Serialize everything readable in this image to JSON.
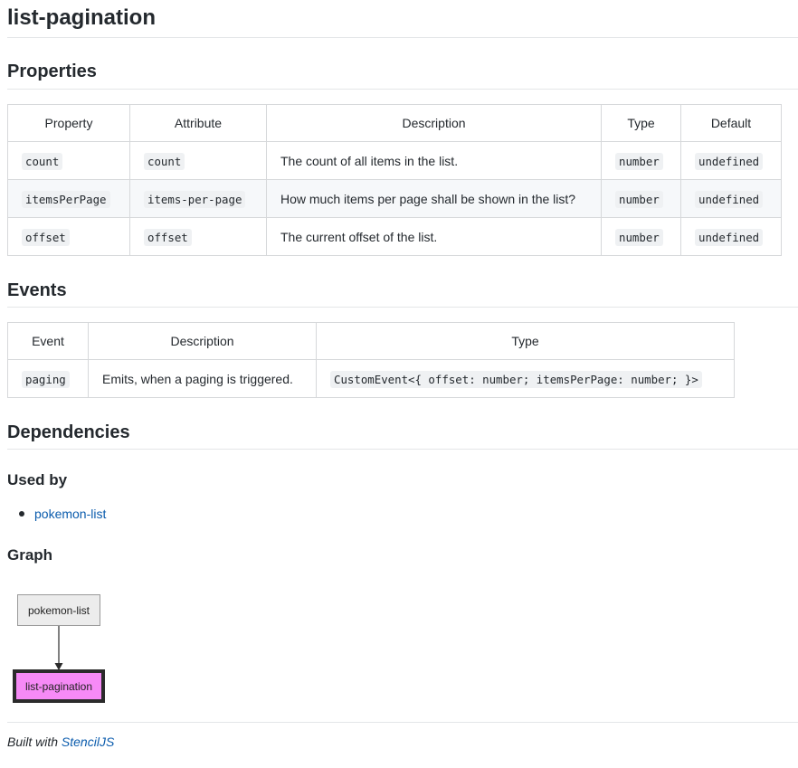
{
  "title": "list-pagination",
  "properties": {
    "heading": "Properties",
    "columns": [
      "Property",
      "Attribute",
      "Description",
      "Type",
      "Default"
    ],
    "rows": [
      {
        "property": "count",
        "attribute": "count",
        "description": "The count of all items in the list.",
        "type": "number",
        "default": "undefined"
      },
      {
        "property": "itemsPerPage",
        "attribute": "items-per-page",
        "description": "How much items per page shall be shown in the list?",
        "type": "number",
        "default": "undefined"
      },
      {
        "property": "offset",
        "attribute": "offset",
        "description": "The current offset of the list.",
        "type": "number",
        "default": "undefined"
      }
    ]
  },
  "events": {
    "heading": "Events",
    "columns": [
      "Event",
      "Description",
      "Type"
    ],
    "rows": [
      {
        "event": "paging",
        "description": "Emits, when a paging is triggered.",
        "type": "CustomEvent<{ offset: number; itemsPerPage: number; }>"
      }
    ]
  },
  "dependencies": {
    "heading": "Dependencies",
    "used_by_heading": "Used by",
    "used_by": [
      "pokemon-list"
    ],
    "graph_heading": "Graph",
    "graph": {
      "parent_node": "pokemon-list",
      "child_node": "list-pagination",
      "parent_color": "#ececec",
      "child_color": "#f68af6"
    }
  },
  "footer": {
    "prefix": "Built with",
    "link": "StencilJS"
  },
  "colors": {
    "link": "#0b5cad",
    "text": "#24292e"
  }
}
